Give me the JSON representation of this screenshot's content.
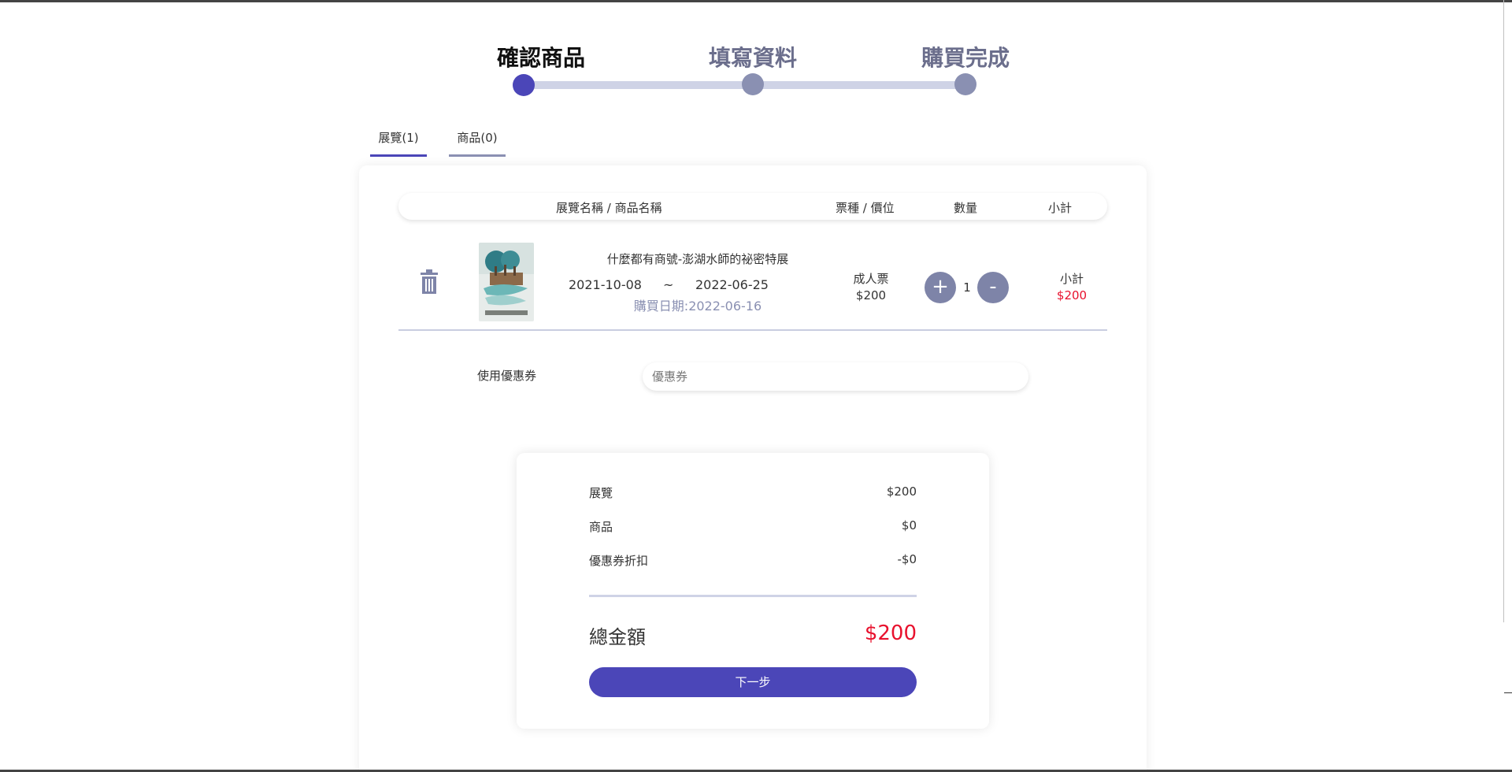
{
  "steps": [
    {
      "label": "確認商品",
      "active": true
    },
    {
      "label": "填寫資料",
      "active": false
    },
    {
      "label": "購買完成",
      "active": false
    }
  ],
  "tabs": [
    {
      "label": "展覽(1)",
      "active": true
    },
    {
      "label": "商品(0)",
      "active": false
    }
  ],
  "table_header": {
    "name": "展覽名稱 / 商品名稱",
    "ticket": "票種 / 價位",
    "qty": "數量",
    "subtotal": "小計"
  },
  "item": {
    "name": "什麼都有商號-澎湖水師的祕密特展",
    "date_start": "2021-10-08",
    "date_sep": "~",
    "date_end": "2022-06-25",
    "purchase_date": "購買日期:2022-06-16",
    "ticket_type": "成人票",
    "ticket_price": "$200",
    "plus": "+",
    "minus": "-",
    "quantity": "1",
    "subtotal_label": "小計",
    "subtotal_value": "$200"
  },
  "coupon": {
    "label": "使用優惠券",
    "placeholder": "優惠券"
  },
  "summary": {
    "exhibition_label": "展覽",
    "exhibition_value": "$200",
    "goods_label": "商品",
    "goods_value": "$0",
    "discount_label": "優惠券折扣",
    "discount_value": "-$0",
    "total_label": "總金額",
    "total_value": "$200",
    "next_button": "下一步"
  },
  "colors": {
    "accent": "#4b46b8",
    "inactive": "#8a90b2",
    "price_red": "#e8112d"
  }
}
